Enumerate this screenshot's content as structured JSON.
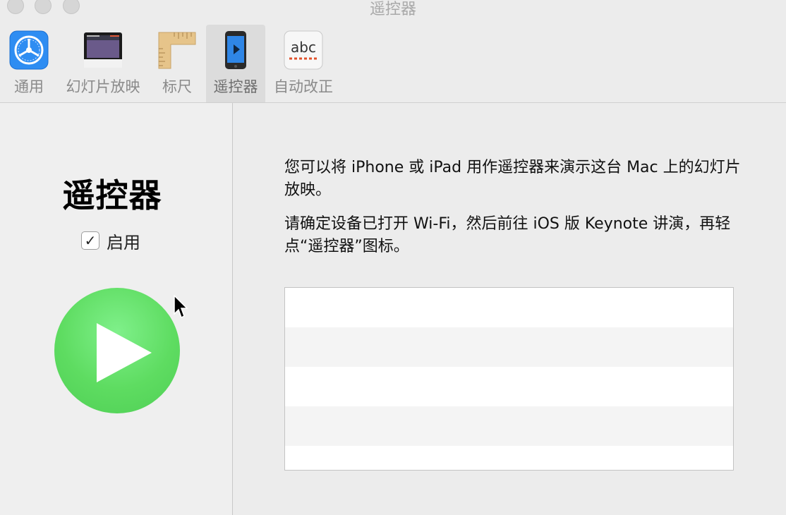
{
  "window": {
    "title": "遥控器"
  },
  "toolbar": {
    "items": [
      {
        "label": "通用",
        "icon": "gear-icon"
      },
      {
        "label": "幻灯片放映",
        "icon": "slideshow-icon"
      },
      {
        "label": "标尺",
        "icon": "ruler-icon"
      },
      {
        "label": "遥控器",
        "icon": "remote-device-icon"
      },
      {
        "label": "自动改正",
        "icon": "autocorrect-icon",
        "icon_text": "abc"
      }
    ],
    "selected": "遥控器"
  },
  "sidebar": {
    "heading": "遥控器",
    "enable_label": "启用",
    "enable_checked": true,
    "check_glyph": "✓"
  },
  "main": {
    "paragraph1": "您可以将 iPhone 或 iPad 用作遥控器来演示这台 Mac 上的幻灯片放映。",
    "paragraph2": "请确定设备已打开 Wi-Fi，然后前往 iOS 版 Keynote 讲演，再轻点“遥控器”图标。",
    "device_list": {
      "rows": 5
    }
  },
  "colors": {
    "play_green": "#5edc61",
    "window_bg": "#ececec"
  }
}
